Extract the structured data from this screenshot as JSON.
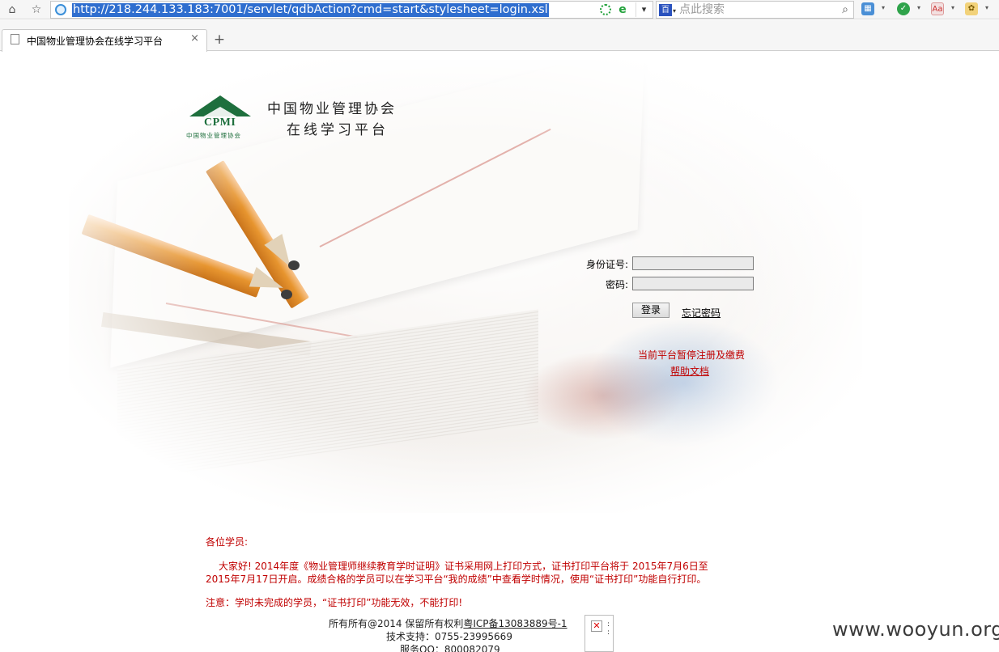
{
  "browser": {
    "url": "http://218.244.133.183:7001/servlet/qdbAction?cmd=start&stylesheet=login.xsl",
    "search_placeholder": "点此搜索",
    "tab_title": "中国物业管理协会在线学习平台",
    "new_tab_symbol": "+",
    "close_symbol": "×"
  },
  "logo": {
    "emblem_text": "CPMI",
    "emblem_subtitle": "中国物业管理协会",
    "site_name_line1": "中国物业管理协会",
    "site_name_line2": "在线学习平台",
    "brand_color": "#1e6f3d"
  },
  "login": {
    "id_label": "身份证号:",
    "password_label": "密码:",
    "login_button": "登录",
    "forgot_password": "忘记密码",
    "pause_notice": "当前平台暂停注册及缴费",
    "help_link": "帮助文档"
  },
  "notice": {
    "greeting": "各位学员:",
    "paragraph_line1": "大家好! 2014年度《物业管理师继续教育学时证明》证书采用网上打印方式，证书打印平台将于  2015年7月6日至",
    "paragraph_line2": "2015年7月17日开启。成绩合格的学员可以在学习平台“我的成绩”中查看学时情况，使用“证书打印”功能自行打印。",
    "warning": "注意：学时未完成的学员，“证书打印”功能无效，不能打印!",
    "color": "#c00000"
  },
  "footer": {
    "copyright": "所有所有@2014 保留所有权利",
    "icp": "粤ICP备13083889号-1",
    "support": "技术支持：0755-23995669",
    "service_qq": "服务QQ：800082079"
  },
  "watermark": "www.wooyun.org"
}
